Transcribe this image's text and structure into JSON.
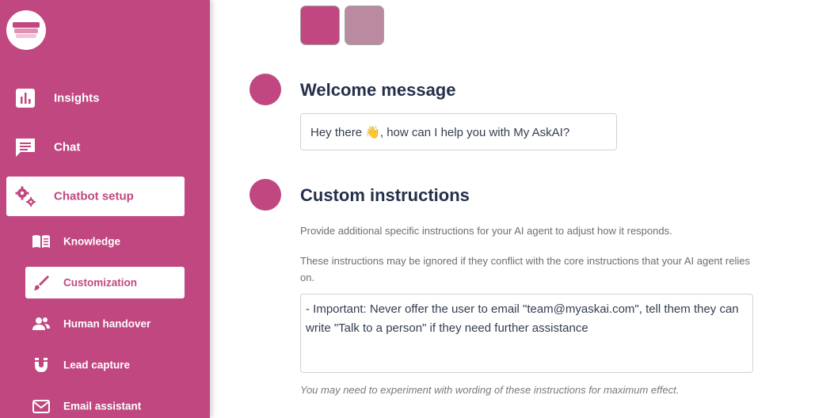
{
  "sidebar": {
    "nav": [
      {
        "label": "Insights",
        "icon": "bar-chart-icon"
      },
      {
        "label": "Chat",
        "icon": "chat-icon"
      },
      {
        "label": "Chatbot setup",
        "icon": "gears-icon"
      }
    ],
    "sub_nav": [
      {
        "label": "Knowledge",
        "icon": "book-icon"
      },
      {
        "label": "Customization",
        "icon": "brush-icon"
      },
      {
        "label": "Human handover",
        "icon": "people-icon"
      },
      {
        "label": "Lead capture",
        "icon": "magnet-icon"
      },
      {
        "label": "Email assistant",
        "icon": "envelope-icon"
      }
    ]
  },
  "colors": {
    "brand": "#c04780",
    "swatch_primary": "#c04780",
    "swatch_secondary": "#b98aa0"
  },
  "welcome": {
    "title": "Welcome message",
    "value": "Hey there 👋, how can I help you with My AskAI?"
  },
  "custom_instructions": {
    "title": "Custom instructions",
    "help_1": "Provide additional specific instructions for your AI agent to adjust how it responds.",
    "help_2": "These instructions may be ignored if they conflict with the core instructions that your AI agent relies on.",
    "value": "- Important: Never offer the user to email \"team@myaskai.com\", tell them they can write \"Talk to a person\" if they need further assistance",
    "footnote": "You may need to experiment with wording of these instructions for maximum effect."
  }
}
